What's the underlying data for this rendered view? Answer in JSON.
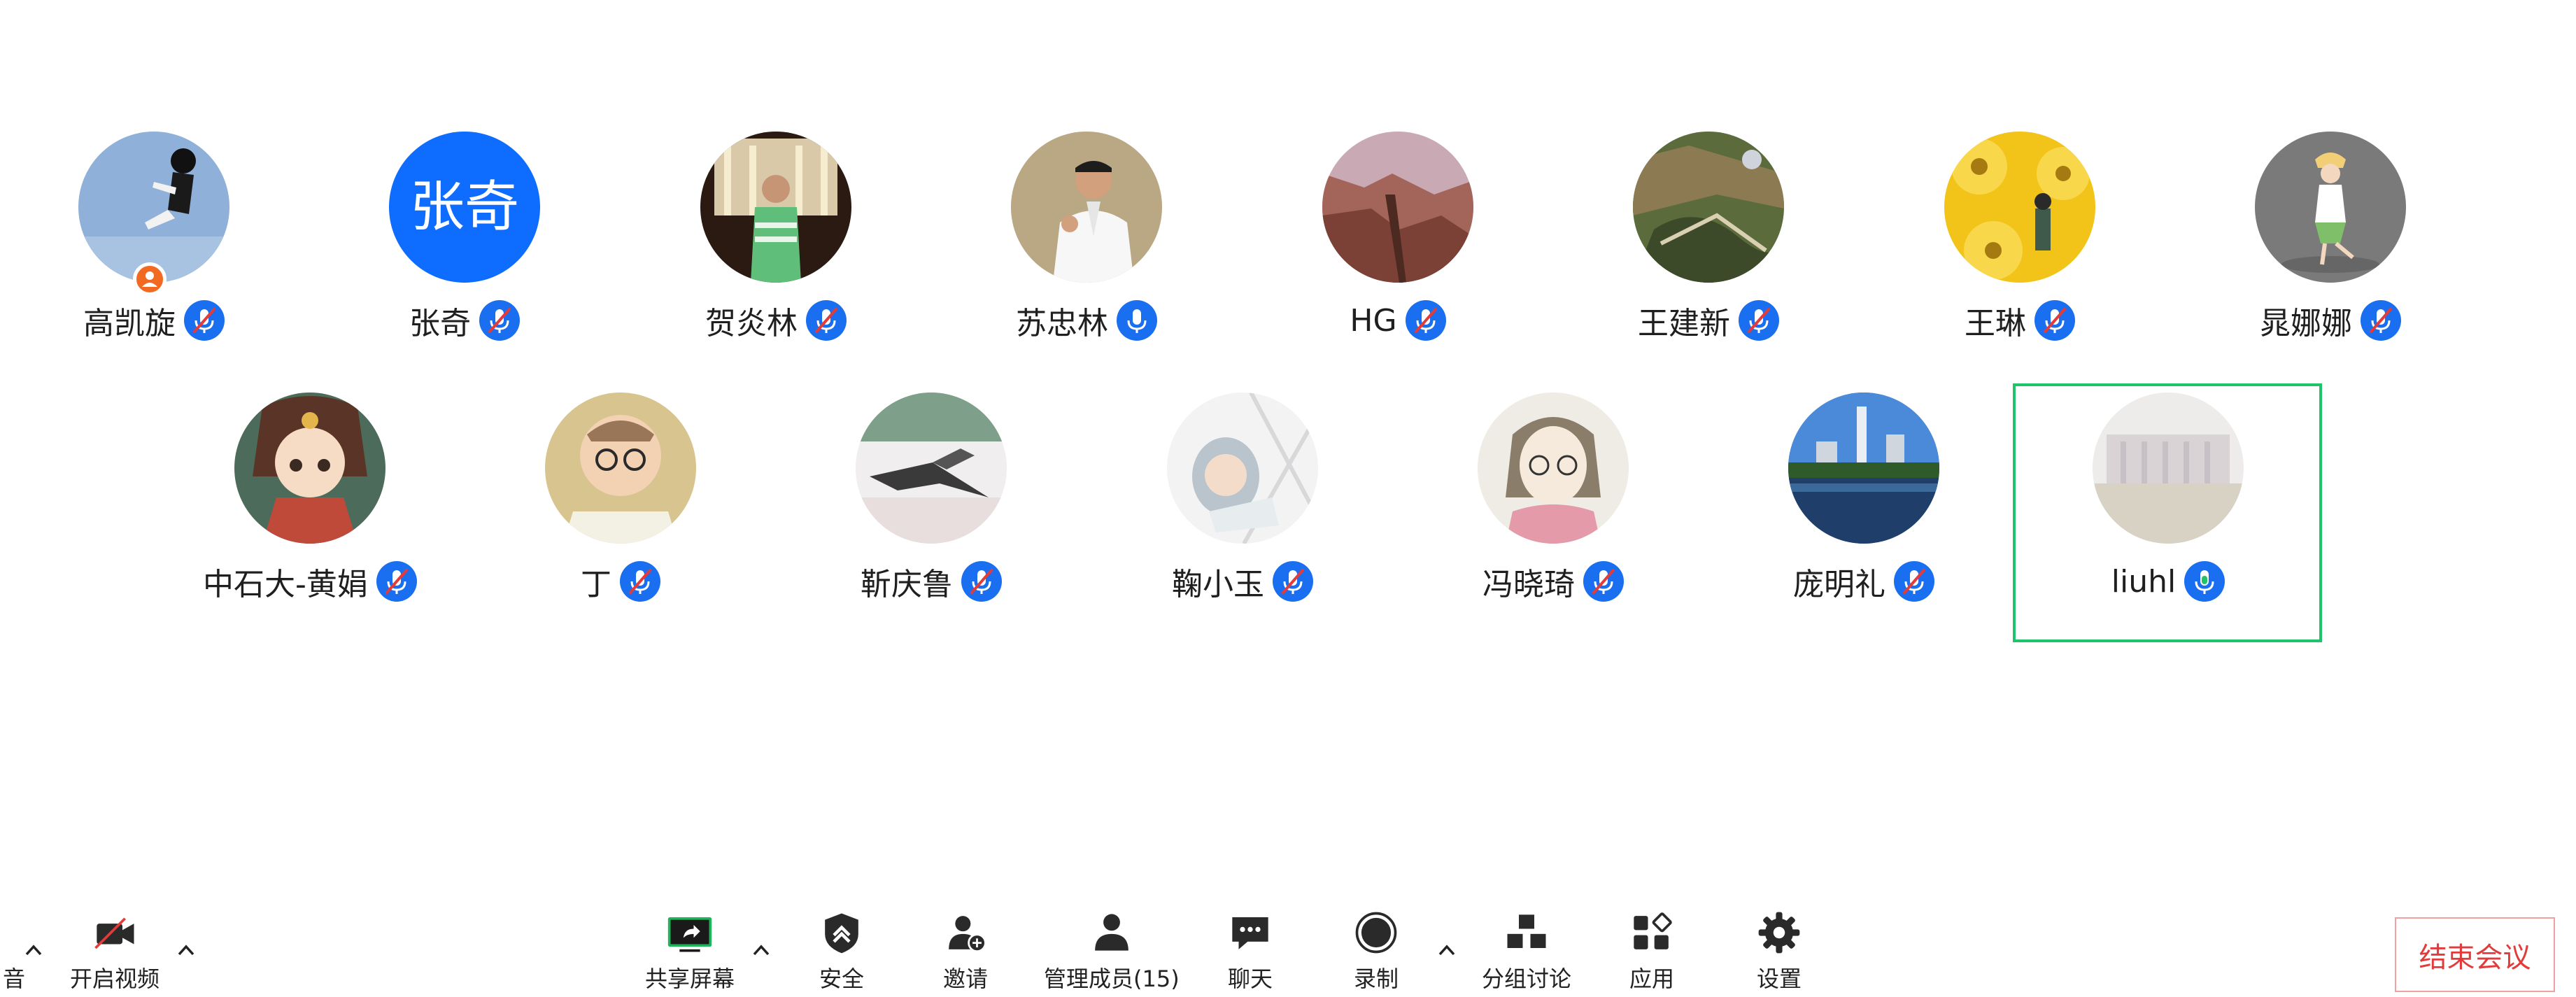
{
  "participants": [
    {
      "name": "高凯旋",
      "mic": "muted",
      "host": true
    },
    {
      "name": "张奇",
      "mic": "muted",
      "avatar_text": "张奇"
    },
    {
      "name": "贺炎林",
      "mic": "muted"
    },
    {
      "name": "苏忠林",
      "mic": "on"
    },
    {
      "name": "HG",
      "mic": "muted"
    },
    {
      "name": "王建新",
      "mic": "muted"
    },
    {
      "name": "王琳",
      "mic": "muted"
    },
    {
      "name": "晁娜娜",
      "mic": "muted"
    },
    {
      "name": "中石大-黄娟",
      "mic": "muted"
    },
    {
      "name": "丁",
      "mic": "muted"
    },
    {
      "name": "靳庆鲁",
      "mic": "muted"
    },
    {
      "name": "鞠小玉",
      "mic": "muted"
    },
    {
      "name": "冯晓琦",
      "mic": "muted"
    },
    {
      "name": "庞明礼",
      "mic": "muted"
    },
    {
      "name": "liuhl",
      "mic": "speaking",
      "active_speaker": true
    }
  ],
  "toolbar": {
    "audio_partial": "音",
    "start_video": "开启视频",
    "share_screen": "共享屏幕",
    "security": "安全",
    "invite": "邀请",
    "manage_participants": "管理成员(15)",
    "chat": "聊天",
    "record": "录制",
    "breakout_rooms": "分组讨论",
    "apps": "应用",
    "settings": "设置",
    "end_meeting": "结束会议"
  },
  "colors": {
    "accent_blue": "#1a6ff0",
    "speaking_green": "#1fc36a",
    "share_green": "#1fb35a",
    "end_red": "#e23b3b",
    "host_orange": "#f26a21"
  },
  "icons": {
    "mic_muted": "mic-muted-icon",
    "mic_on": "mic-icon",
    "host": "host-badge-icon",
    "video_off": "video-off-icon",
    "share": "share-screen-icon",
    "security": "shield-icon",
    "invite": "add-user-icon",
    "participants": "participants-icon",
    "chat": "chat-icon",
    "record": "record-icon",
    "breakout": "breakout-rooms-icon",
    "apps": "apps-icon",
    "settings": "gear-icon"
  }
}
